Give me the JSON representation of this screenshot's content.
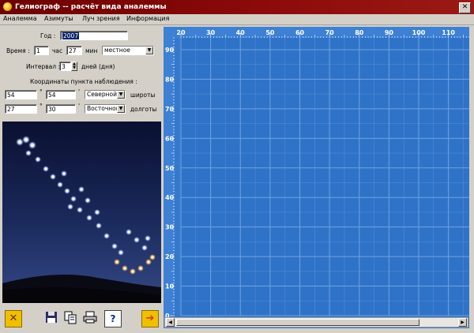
{
  "window": {
    "title": "Гелиограф -- расчёт вида аналеммы",
    "close_glyph": "✕"
  },
  "menu": {
    "items": [
      "Аналемма",
      "Азимуты",
      "Луч зрения",
      "Информация"
    ]
  },
  "form": {
    "year_label": "Год :",
    "year_value": "2007",
    "time_label": "Время :",
    "hour_value": "1",
    "hour_unit": "час",
    "minute_value": "27",
    "minute_unit": "мин",
    "timezone_value": "местное",
    "interval_label": "Интервал :",
    "interval_value": "3",
    "interval_unit": "дней (дня)",
    "coords_heading": "Координаты пункта наблюдения :",
    "lat_deg": "54",
    "lat_deg_sym": "°",
    "lat_min": "54",
    "lat_min_sym": "'",
    "lat_hemisphere": "Северной",
    "lat_word": "широты",
    "lon_deg": "27",
    "lon_deg_sym": "°",
    "lon_min": "30",
    "lon_min_sym": "'",
    "lon_hemisphere": "Восточной",
    "lon_word": "долготы"
  },
  "toolbar": {
    "calculate_icon": "✕",
    "save_icon": "floppy",
    "copy_icon": "copy",
    "print_icon": "printer",
    "help_label": "?",
    "next_icon": "➔"
  },
  "chart_data": {
    "type": "scatter",
    "x_ticks": [
      20,
      30,
      40,
      50,
      60,
      70,
      80,
      90,
      100,
      110
    ],
    "y_ticks": [
      90,
      80,
      70,
      60,
      50,
      40,
      30,
      20,
      10,
      0
    ],
    "xlim": [
      20,
      117
    ],
    "ylim": [
      0,
      94
    ],
    "grid": true,
    "points": [],
    "colors": {
      "background": "#2f73c8",
      "grid": "#6da3e2",
      "tick_text": "#ffffff"
    }
  }
}
